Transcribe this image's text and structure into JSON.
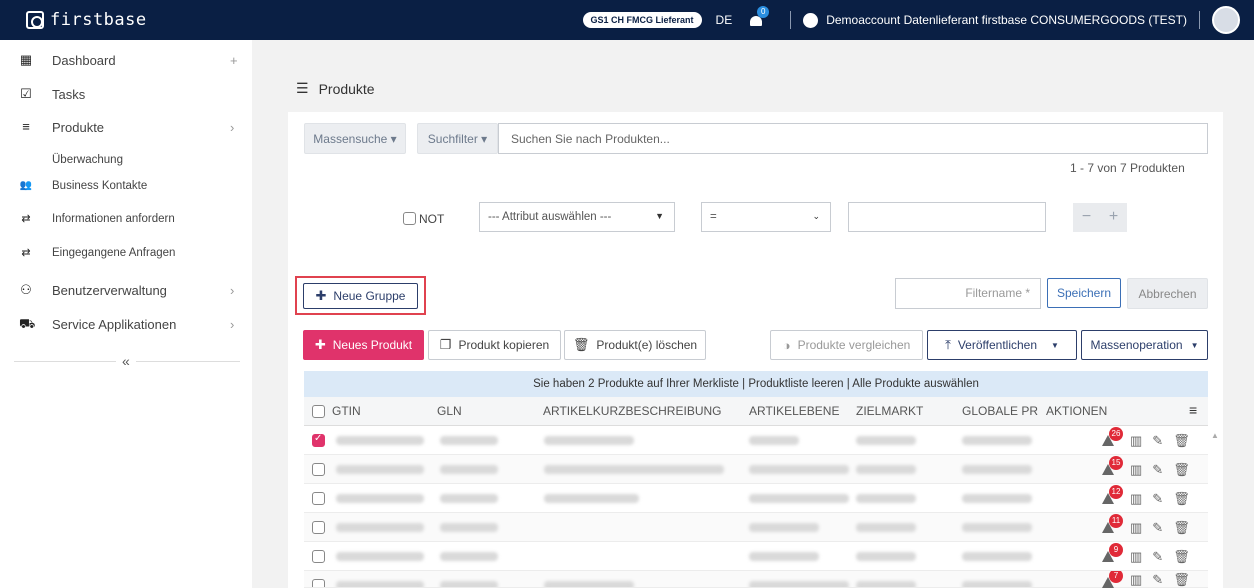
{
  "header": {
    "logo_text": "firstbase",
    "gs1_badge": "GS1 CH FMCG Lieferant",
    "language": "DE",
    "notification_count": "0",
    "account": "Demoaccount Datenlieferant firstbase CONSUMERGOODS (TEST)"
  },
  "sidebar": {
    "items": [
      {
        "label": "Dashboard",
        "icon": "grid-icon"
      },
      {
        "label": "Tasks",
        "icon": "checkbox-icon"
      },
      {
        "label": "Produkte",
        "icon": "list-icon"
      },
      {
        "label": "Überwachung"
      },
      {
        "label": "Business Kontakte",
        "icon": "people-icon"
      },
      {
        "label": "Informationen anfordern",
        "icon": "exchange-icon"
      },
      {
        "label": "Eingegangene Anfragen",
        "icon": "exchange-icon"
      },
      {
        "label": "Benutzerverwaltung",
        "icon": "user-admin-icon"
      },
      {
        "label": "Service Applikationen",
        "icon": "cart-icon"
      }
    ],
    "dashboard_add": "+",
    "collapse": "«"
  },
  "main": {
    "title": "Produkte",
    "massensuche": "Massensuche ▾",
    "suchfilter": "Suchfilter ▾",
    "search_placeholder": "Suchen Sie nach Produkten...",
    "count": "1 - 7 von 7 Produkten",
    "filter": {
      "not_label": "NOT",
      "attribute": "--- Attribut auswählen ---",
      "operator": "=",
      "minus": "−",
      "plus": "+"
    },
    "neue_gruppe": "Neue Gruppe",
    "filtername_placeholder": "Filtername *",
    "speichern": "Speichern",
    "abbrechen": "Abbrechen",
    "toolbar": {
      "neues_produkt": "Neues Produkt",
      "produkt_kopieren": "Produkt kopieren",
      "produkte_loeschen": "Produkt(e) löschen",
      "vergleichen": "Produkte vergleichen",
      "veroeffentlichen": "Veröffentlichen",
      "massenoperation": "Massenoperation"
    },
    "merkliste": "Sie haben 2 Produkte auf Ihrer Merkliste  |  Produktliste leeren  |  Alle Produkte auswählen",
    "columns": [
      "GTIN",
      "GLN",
      "ARTIKELKURZBESCHREIBUNG",
      "ARTIKELEBENE",
      "ZIELMARKT",
      "GLOBALE PR",
      "AKTIONEN"
    ],
    "rows": [
      {
        "checked": true,
        "warnings": "26"
      },
      {
        "checked": false,
        "warnings": "15"
      },
      {
        "checked": false,
        "warnings": "12"
      },
      {
        "checked": false,
        "warnings": "11"
      },
      {
        "checked": false,
        "warnings": "9"
      },
      {
        "checked": false,
        "warnings": "7"
      }
    ]
  }
}
